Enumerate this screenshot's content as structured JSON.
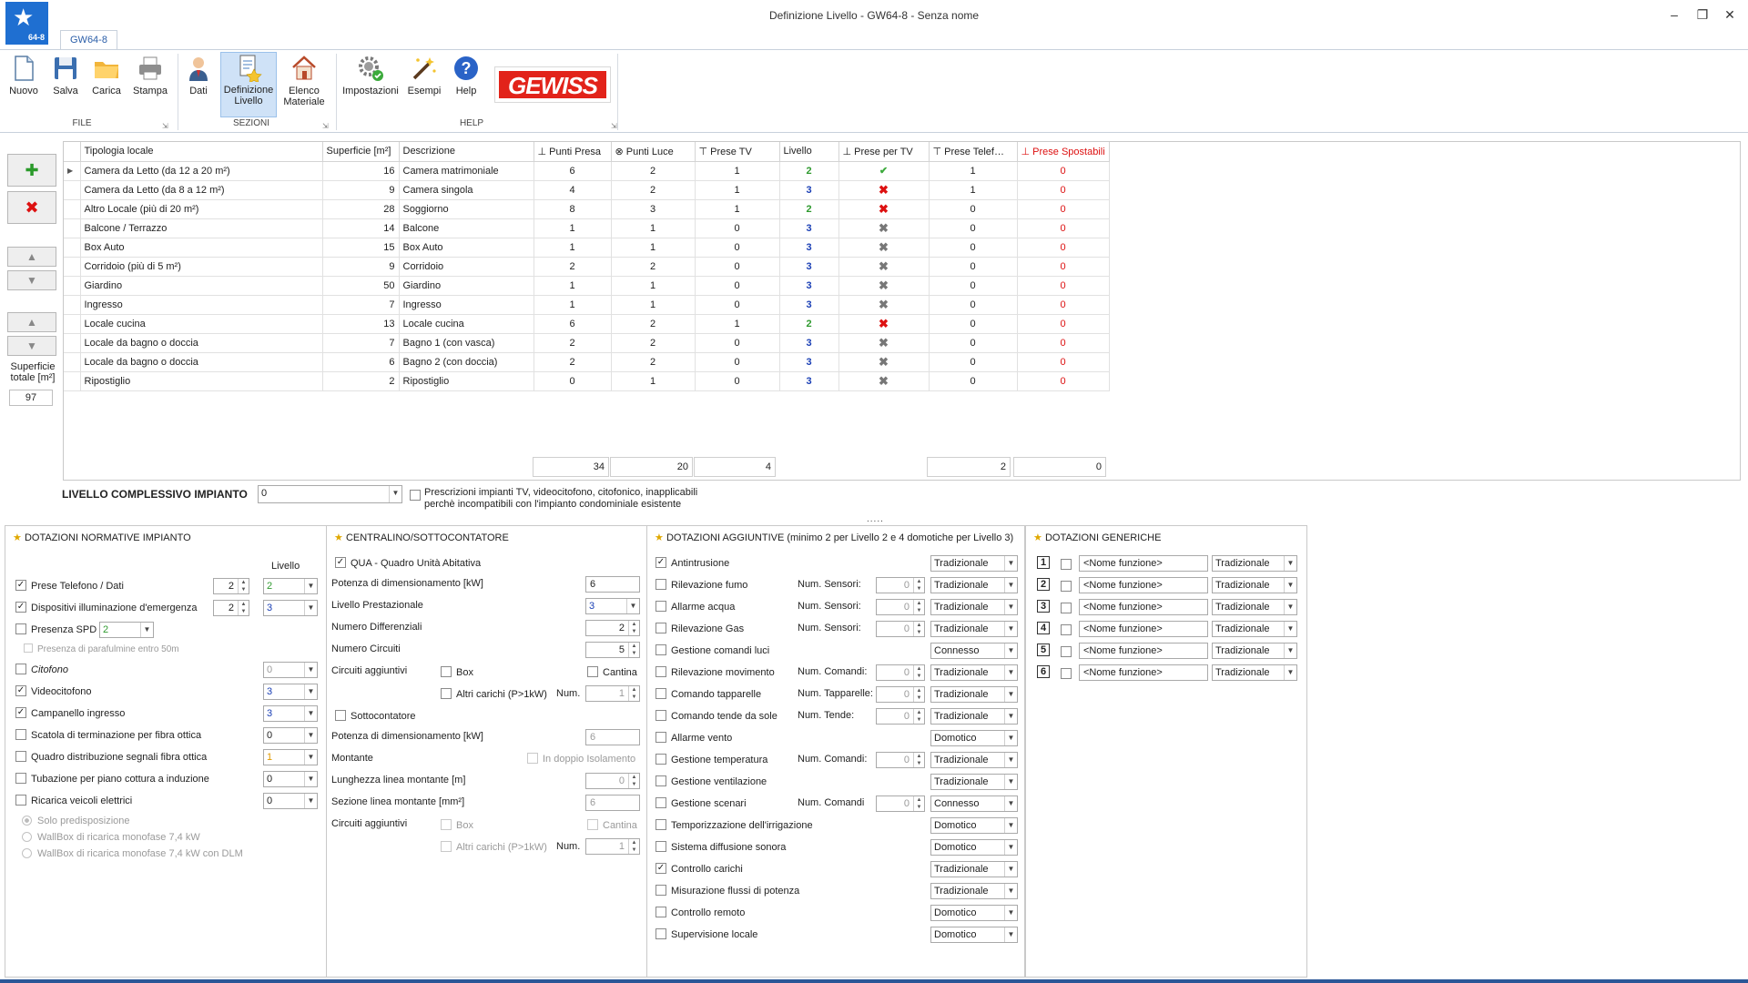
{
  "window": {
    "title": "Definizione Livello - GW64-8 - Senza nome",
    "app_badge": "64-8",
    "tab": "GW64-8"
  },
  "ribbon": {
    "file": {
      "group": "FILE",
      "nuovo": "Nuovo",
      "salva": "Salva",
      "carica": "Carica",
      "stampa": "Stampa"
    },
    "sezioni": {
      "group": "SEZIONI",
      "dati": "Dati",
      "definizione_livello": [
        "Definizione",
        "Livello"
      ],
      "elenco_materiale": [
        "Elenco",
        "Materiale"
      ]
    },
    "help": {
      "group": "HELP",
      "impostazioni": "Impostazioni",
      "esempi": "Esempi",
      "help": "Help"
    },
    "logo": "GEWISS"
  },
  "left_panel": {
    "superficie_label": [
      "Superficie",
      "totale [m²]"
    ],
    "superficie_value": "97"
  },
  "grid": {
    "columns": [
      "Tipologia locale",
      "Superficie [m²]",
      "Descrizione",
      "Punti Presa",
      "Punti Luce",
      "Prese TV",
      "Livello",
      "Prese per TV",
      "Prese Telef…",
      "Prese Spostabili"
    ],
    "rows": [
      [
        "Camera da Letto (da 12 a 20 m²)",
        "16",
        "Camera matrimoniale",
        "6",
        "2",
        "1",
        "2",
        "ok",
        "1",
        "0"
      ],
      [
        "Camera da Letto (da 8 a 12 m²)",
        "9",
        "Camera singola",
        "4",
        "2",
        "1",
        "3",
        "xr",
        "1",
        "0"
      ],
      [
        "Altro Locale (più di 20 m²)",
        "28",
        "Soggiorno",
        "8",
        "3",
        "1",
        "2",
        "xr",
        "0",
        "0"
      ],
      [
        "Balcone / Terrazzo",
        "14",
        "Balcone",
        "1",
        "1",
        "0",
        "3",
        "xg",
        "0",
        "0"
      ],
      [
        "Box Auto",
        "15",
        "Box Auto",
        "1",
        "1",
        "0",
        "3",
        "xg",
        "0",
        "0"
      ],
      [
        "Corridoio (più di 5 m²)",
        "9",
        "Corridoio",
        "2",
        "2",
        "0",
        "3",
        "xg",
        "0",
        "0"
      ],
      [
        "Giardino",
        "50",
        "Giardino",
        "1",
        "1",
        "0",
        "3",
        "xg",
        "0",
        "0"
      ],
      [
        "Ingresso",
        "7",
        "Ingresso",
        "1",
        "1",
        "0",
        "3",
        "xg",
        "0",
        "0"
      ],
      [
        "Locale cucina",
        "13",
        "Locale cucina",
        "6",
        "2",
        "1",
        "2",
        "xr",
        "0",
        "0"
      ],
      [
        "Locale da bagno o doccia",
        "7",
        "Bagno 1 (con vasca)",
        "2",
        "2",
        "0",
        "3",
        "xg",
        "0",
        "0"
      ],
      [
        "Locale da bagno o doccia",
        "6",
        "Bagno 2 (con doccia)",
        "2",
        "2",
        "0",
        "3",
        "xg",
        "0",
        "0"
      ],
      [
        "Ripostiglio",
        "2",
        "Ripostiglio",
        "0",
        "1",
        "0",
        "3",
        "xg",
        "0",
        "0"
      ]
    ],
    "totals": {
      "punti_presa": "34",
      "punti_luce": "20",
      "prese_tv": "4",
      "prese_telef": "2",
      "prese_spostabili": "0"
    }
  },
  "livello": {
    "label": "LIVELLO COMPLESSIVO IMPIANTO",
    "value": "0",
    "prescrizioni": [
      "Prescrizioni impianti TV, videocitofono, citofonico, inapplicabili",
      "perchè incompatibili con l'impianto condominiale esistente"
    ],
    "splitter": "....."
  },
  "dotazioni_normative": {
    "title": "DOTAZIONI NORMATIVE IMPIANTO",
    "livello_header": "Livello",
    "prese_telefono": {
      "label": "Prese Telefono / Dati",
      "num": "2",
      "level": "2"
    },
    "illuminazione": {
      "label": "Dispositivi illuminazione d'emergenza",
      "num": "2",
      "level": "3"
    },
    "spd": {
      "label": "Presenza SPD",
      "level": "2"
    },
    "parafulmine": "Presenza di parafulmine entro 50m",
    "citofono": {
      "label": "Citofono",
      "level": "0"
    },
    "videocitofono": {
      "label": "Videocitofono",
      "level": "3"
    },
    "campanello": {
      "label": "Campanello ingresso",
      "level": "3"
    },
    "scatola_fibra": {
      "label": "Scatola di terminazione per fibra ottica",
      "level": "0"
    },
    "quadro_fibra": {
      "label": "Quadro distribuzione segnali fibra ottica",
      "level": "1"
    },
    "tubazione": {
      "label": "Tubazione per piano cottura a induzione",
      "level": "0"
    },
    "ricarica": {
      "label": "Ricarica veicoli elettrici",
      "level": "0"
    },
    "radio": [
      "Solo predisposizione",
      "WallBox di ricarica monofase 7,4 kW",
      "WallBox di ricarica monofase 7,4 kW con DLM"
    ]
  },
  "centralino": {
    "title": "CENTRALINO/SOTTOCONTATORE",
    "qua": "QUA - Quadro Unità Abitativa",
    "potenza_label": "Potenza di dimensionamento [kW]",
    "potenza": "6",
    "prestazionale_label": "Livello Prestazionale",
    "prestazionale": "3",
    "differenziali_label": "Numero Differenziali",
    "differenziali": "2",
    "circuiti_label": "Numero Circuiti",
    "circuiti": "5",
    "aggiuntivi_label": "Circuiti aggiuntivi",
    "box": "Box",
    "cantina": "Cantina",
    "altri": "Altri carichi (P>1kW)",
    "num_label": "Num.",
    "num": "1",
    "sottocontatore": "Sottocontatore",
    "potenza2_label": "Potenza di dimensionamento [kW]",
    "potenza2": "6",
    "montante_label": "Montante",
    "doppio": "In doppio Isolamento",
    "lunghezza_label": "Lunghezza linea montante [m]",
    "lunghezza": "0",
    "sezione_label": "Sezione linea montante [mm²]",
    "sezione": "6",
    "aggiuntivi2_label": "Circuiti aggiuntivi",
    "box2": "Box",
    "cantina2": "Cantina",
    "altri2": "Altri carichi (P>1kW)",
    "num2_label": "Num.",
    "num2": "1"
  },
  "dotazioni_aggiuntive": {
    "title": "DOTAZIONI AGGIUNTIVE (minimo 2 per Livello 2 e 4 domotiche per Livello 3)",
    "items": [
      {
        "label": "Antintrusione",
        "checked": true,
        "extra": "",
        "num": "",
        "mode": "Tradizionale"
      },
      {
        "label": "Rilevazione fumo",
        "checked": false,
        "extra": "Num. Sensori:",
        "num": "0",
        "mode": "Tradizionale"
      },
      {
        "label": "Allarme acqua",
        "checked": false,
        "extra": "Num. Sensori:",
        "num": "0",
        "mode": "Tradizionale"
      },
      {
        "label": "Rilevazione Gas",
        "checked": false,
        "extra": "Num. Sensori:",
        "num": "0",
        "mode": "Tradizionale"
      },
      {
        "label": "Gestione comandi luci",
        "checked": false,
        "extra": "",
        "num": "",
        "mode": "Connesso"
      },
      {
        "label": "Rilevazione movimento",
        "checked": false,
        "extra": "Num. Comandi:",
        "num": "0",
        "mode": "Tradizionale"
      },
      {
        "label": "Comando tapparelle",
        "checked": false,
        "extra": "Num. Tapparelle:",
        "num": "0",
        "mode": "Tradizionale"
      },
      {
        "label": "Comando tende da sole",
        "checked": false,
        "extra": "Num. Tende:",
        "num": "0",
        "mode": "Tradizionale"
      },
      {
        "label": "Allarme vento",
        "checked": false,
        "extra": "",
        "num": "",
        "mode": "Domotico"
      },
      {
        "label": "Gestione temperatura",
        "checked": false,
        "extra": "Num. Comandi:",
        "num": "0",
        "mode": "Tradizionale"
      },
      {
        "label": "Gestione ventilazione",
        "checked": false,
        "extra": "",
        "num": "",
        "mode": "Tradizionale"
      },
      {
        "label": "Gestione scenari",
        "checked": false,
        "extra": "Num. Comandi",
        "num": "0",
        "mode": "Connesso"
      },
      {
        "label": "Temporizzazione dell'irrigazione",
        "checked": false,
        "extra": "",
        "num": "",
        "mode": "Domotico"
      },
      {
        "label": "Sistema diffusione sonora",
        "checked": false,
        "extra": "",
        "num": "",
        "mode": "Domotico"
      },
      {
        "label": "Controllo carichi",
        "checked": true,
        "extra": "",
        "num": "",
        "mode": "Tradizionale"
      },
      {
        "label": "Misurazione flussi di potenza",
        "checked": false,
        "extra": "",
        "num": "",
        "mode": "Tradizionale"
      },
      {
        "label": "Controllo remoto",
        "checked": false,
        "extra": "",
        "num": "",
        "mode": "Domotico"
      },
      {
        "label": "Supervisione locale",
        "checked": false,
        "extra": "",
        "num": "",
        "mode": "Domotico"
      }
    ]
  },
  "dotazioni_generiche": {
    "title": "DOTAZIONI GENERICHE",
    "items": [
      {
        "n": "1",
        "name": "<Nome funzione>",
        "mode": "Tradizionale"
      },
      {
        "n": "2",
        "name": "<Nome funzione>",
        "mode": "Tradizionale"
      },
      {
        "n": "3",
        "name": "<Nome funzione>",
        "mode": "Tradizionale"
      },
      {
        "n": "4",
        "name": "<Nome funzione>",
        "mode": "Tradizionale"
      },
      {
        "n": "5",
        "name": "<Nome funzione>",
        "mode": "Tradizionale"
      },
      {
        "n": "6",
        "name": "<Nome funzione>",
        "mode": "Tradizionale"
      }
    ]
  }
}
